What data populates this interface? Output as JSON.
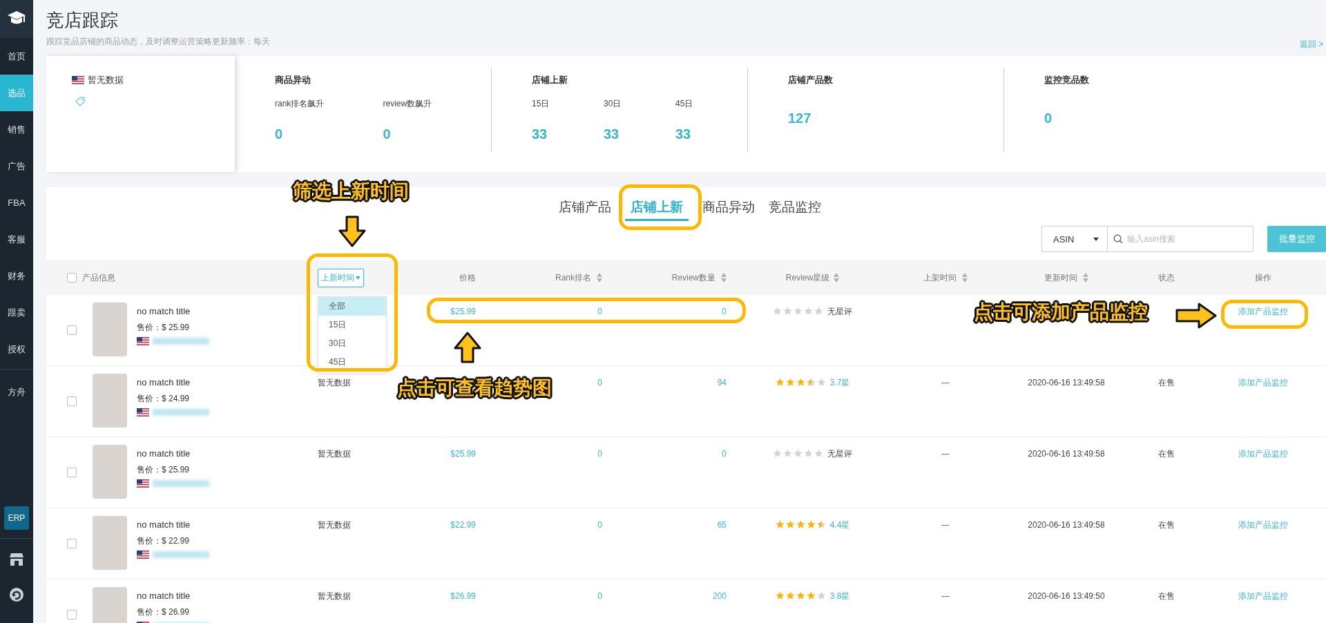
{
  "sidebar": {
    "items": [
      {
        "label": "首页",
        "selected": false
      },
      {
        "label": "选品",
        "selected": true
      },
      {
        "label": "销售",
        "selected": false
      },
      {
        "label": "广告",
        "selected": false
      },
      {
        "label": "FBA",
        "selected": false
      },
      {
        "label": "客服",
        "selected": false
      },
      {
        "label": "财务",
        "selected": false
      },
      {
        "label": "跟卖",
        "selected": false
      },
      {
        "label": "授权",
        "selected": false
      },
      {
        "label": "方舟",
        "selected": false
      }
    ],
    "badge": "ERP"
  },
  "header": {
    "title": "竞店跟踪",
    "subtitle": "跟踪竞品店铺的商品动态，及时调整运营策略更新频率：每天",
    "back_link": "返回 >"
  },
  "summary": {
    "store_label": "暂无数据",
    "groups": [
      {
        "title": "商品异动",
        "metrics": [
          {
            "label": "rank排名飙升",
            "value": "0"
          },
          {
            "label": "review数飙升",
            "value": "0"
          }
        ]
      },
      {
        "title": "店铺上新",
        "metrics": [
          {
            "label": "15日",
            "value": "33"
          },
          {
            "label": "30日",
            "value": "33"
          },
          {
            "label": "45日",
            "value": "33"
          }
        ]
      },
      {
        "title": "店铺产品数",
        "metrics": [
          {
            "value": "127"
          }
        ]
      },
      {
        "title": "监控竞品数",
        "metrics": [
          {
            "value": "0"
          }
        ]
      }
    ]
  },
  "tabs": [
    {
      "label": "店铺产品",
      "selected": false
    },
    {
      "label": "店铺上新",
      "selected": true
    },
    {
      "label": "商品异动",
      "selected": false
    },
    {
      "label": "竞品监控",
      "selected": false
    }
  ],
  "toolbar": {
    "search_type": "ASIN",
    "search_placeholder": "输入asin搜索",
    "batch_button": "批量监控"
  },
  "table": {
    "select_all_checked": false,
    "columns": [
      {
        "label": "产品信息",
        "kind": "plain"
      },
      {
        "label": "上新时间",
        "kind": "filter",
        "expanded": true,
        "options": [
          {
            "label": "全部",
            "selected": true
          },
          {
            "label": "15日",
            "selected": false
          },
          {
            "label": "30日",
            "selected": false
          },
          {
            "label": "45日",
            "selected": false
          }
        ]
      },
      {
        "label": "价格",
        "kind": "plain"
      },
      {
        "label": "Rank排名",
        "kind": "sort"
      },
      {
        "label": "Review数量",
        "kind": "sort"
      },
      {
        "label": "Review星级",
        "kind": "sort"
      },
      {
        "label": "上架时间",
        "kind": "sort"
      },
      {
        "label": "更新时间",
        "kind": "sort"
      },
      {
        "label": "状态",
        "kind": "plain"
      },
      {
        "label": "操作",
        "kind": "plain"
      }
    ],
    "rows": [
      {
        "checked": false,
        "title": "no match title",
        "sale_price": "售价：$ 25.99",
        "price": "$25.99",
        "rank": "0",
        "reviews": "0",
        "stars": 0,
        "rating": "无星评",
        "action": "添加产品监控"
      },
      {
        "checked": false,
        "title": "no match title",
        "sale_price": "售价：$ 24.99",
        "new_time": "暂无数据",
        "rank": "0",
        "reviews": "94",
        "stars": 3.5,
        "rating": "3.7星",
        "listed": "---",
        "updated": "2020-06-16 13:49:58",
        "status": "在售",
        "action": "添加产品监控"
      },
      {
        "checked": false,
        "title": "no match title",
        "sale_price": "售价：$ 25.99",
        "new_time": "暂无数据",
        "price": "$25.99",
        "rank": "0",
        "reviews": "0",
        "stars": 0,
        "rating": "无星评",
        "listed": "---",
        "updated": "2020-06-16 13:49:58",
        "status": "在售",
        "action": "添加产品监控"
      },
      {
        "checked": false,
        "title": "no match title",
        "sale_price": "售价：$ 22.99",
        "new_time": "暂无数据",
        "price": "$22.99",
        "rank": "0",
        "reviews": "65",
        "stars": 4.5,
        "rating": "4.4星",
        "listed": "---",
        "updated": "2020-06-16 13:49:58",
        "status": "在售",
        "action": "添加产品监控"
      },
      {
        "checked": false,
        "title": "no match title",
        "sale_price": "售价：$ 26.99",
        "new_time": "暂无数据",
        "price": "$26.99",
        "rank": "0",
        "reviews": "200",
        "stars": 4,
        "rating": "3.8星",
        "listed": "---",
        "updated": "2020-06-16 13:49:50",
        "status": "在售",
        "action": "添加产品监控"
      }
    ]
  },
  "annotations": [
    {
      "text": "筛选上新时间"
    },
    {
      "text": "点击可查看趋势图"
    },
    {
      "text": "点击可添加产品监控"
    }
  ]
}
